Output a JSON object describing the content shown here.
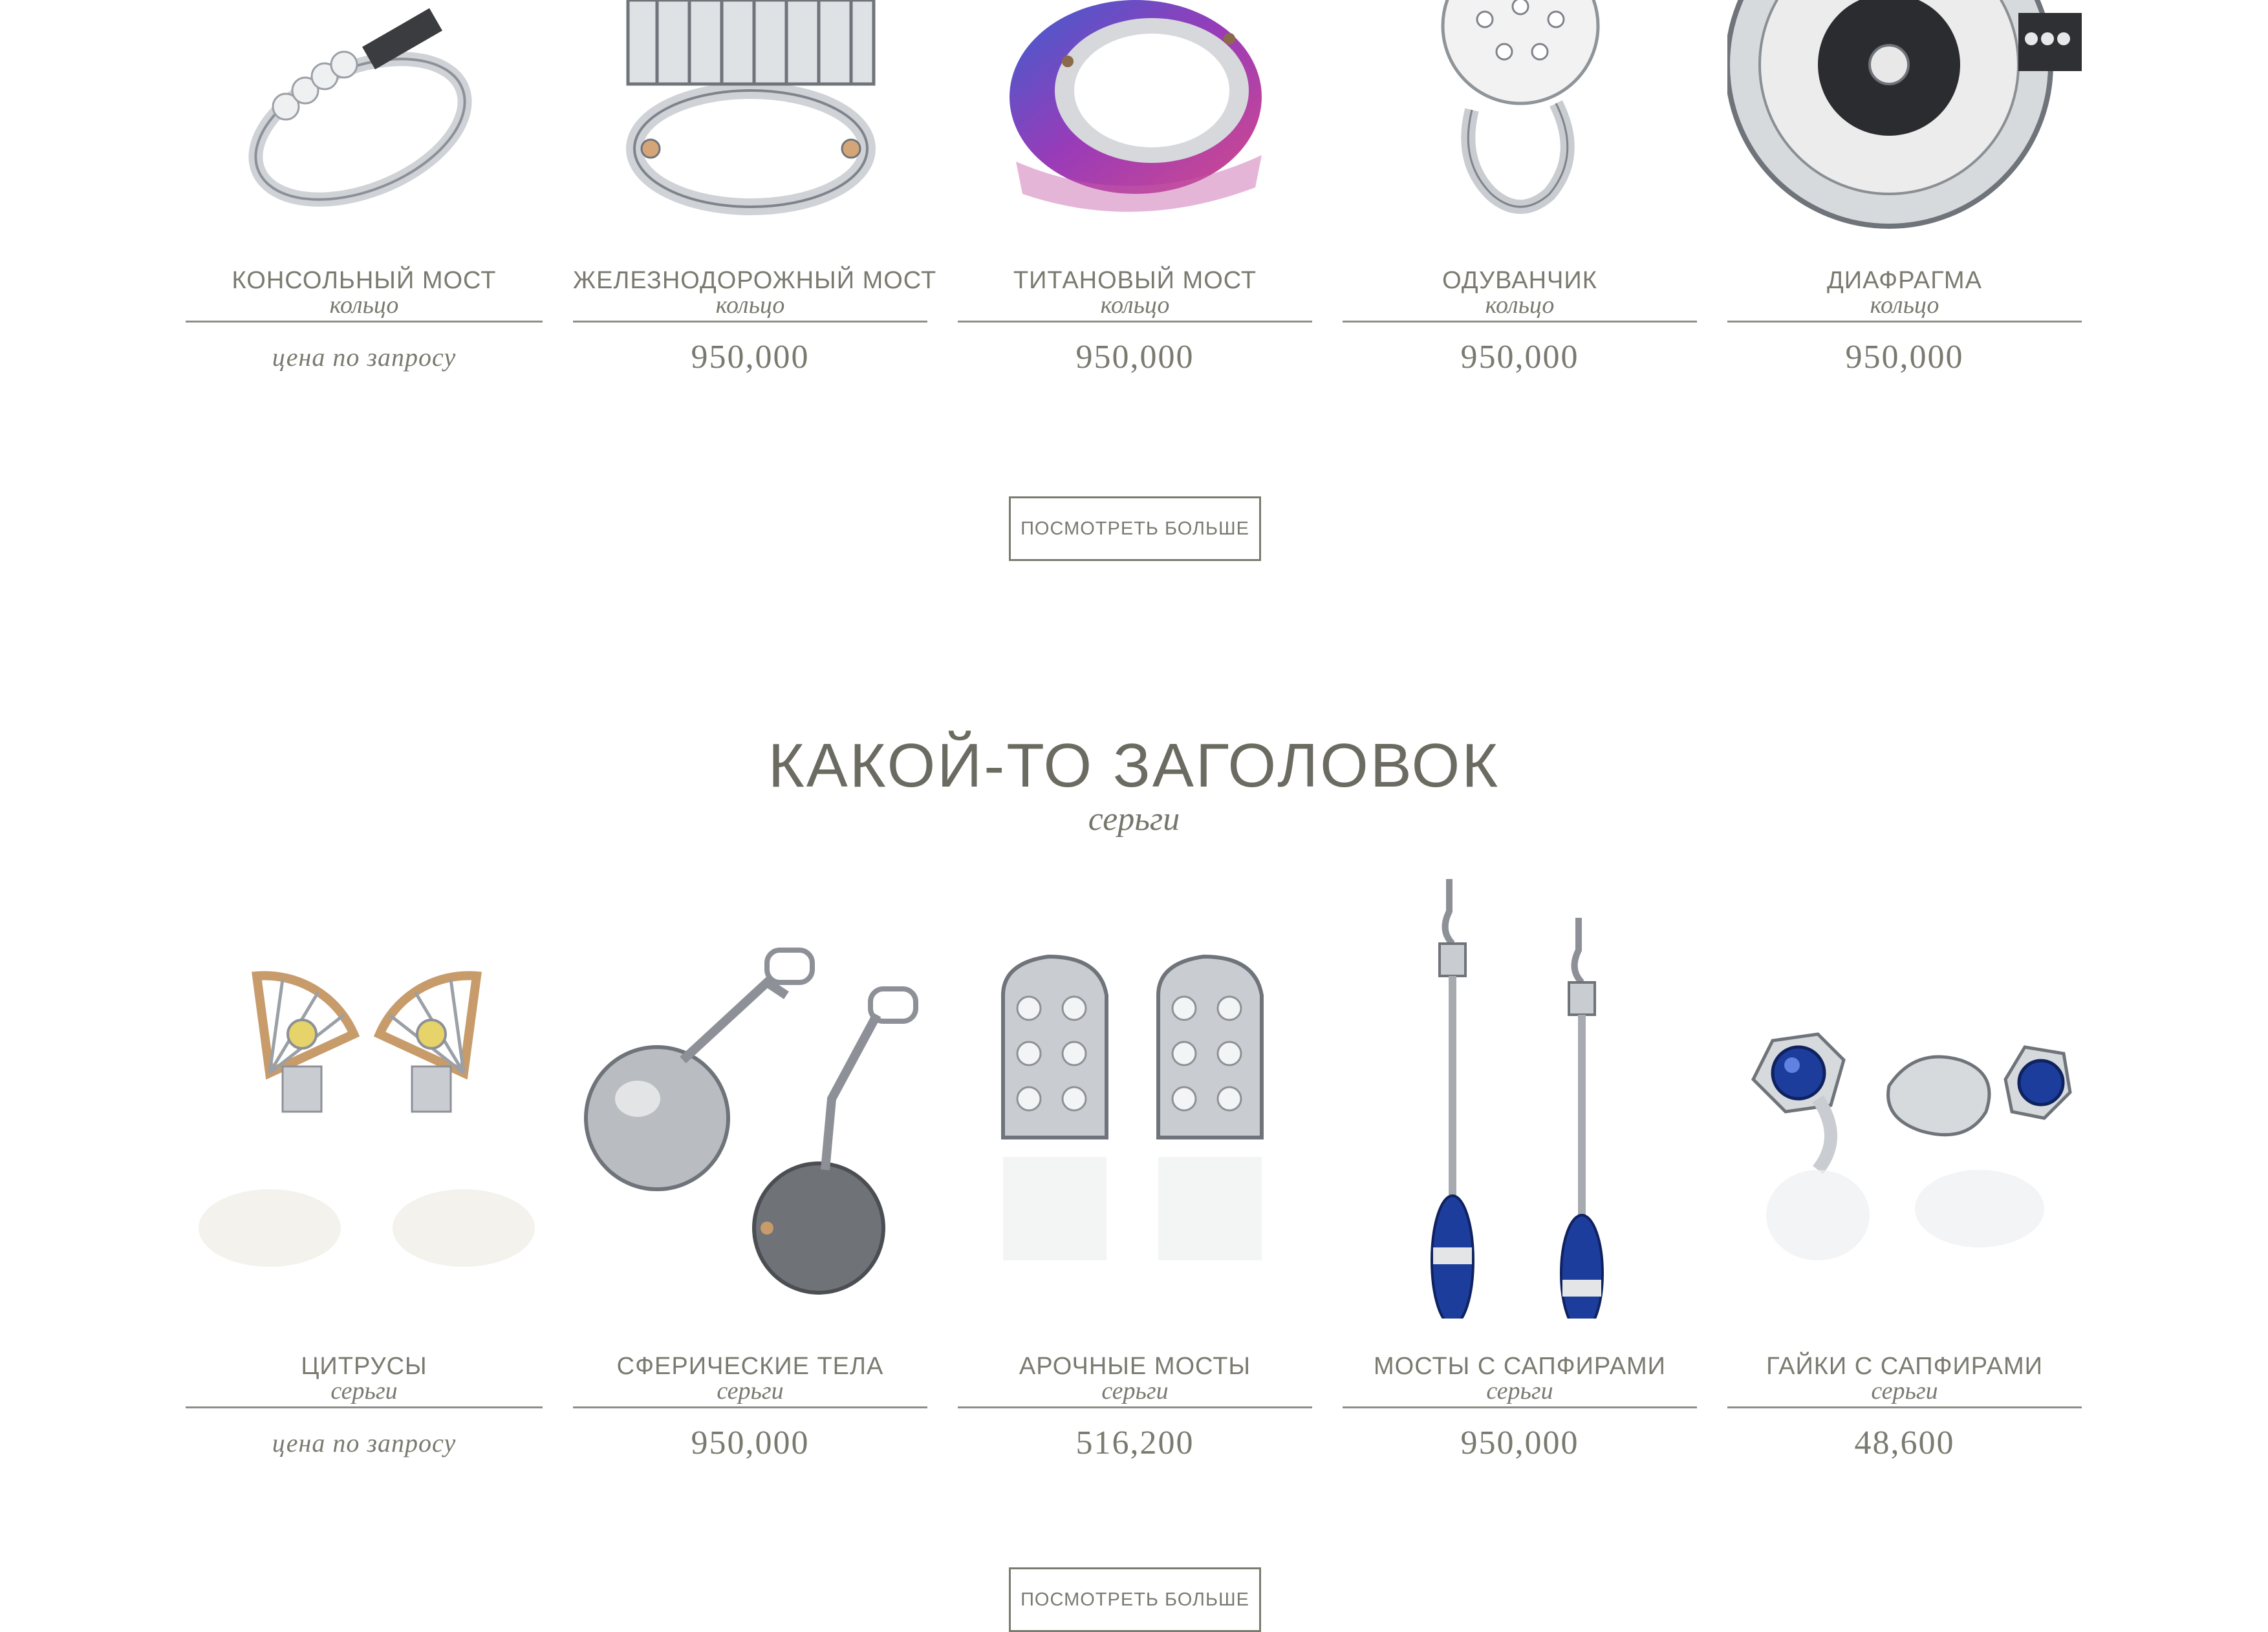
{
  "rings_section": {
    "products": [
      {
        "name": "КОНСОЛЬНЫЙ МОСТ",
        "type": "кольцо",
        "price": "цена по запросу",
        "image": "ring-icon"
      },
      {
        "name": "ЖЕЛЕЗНОДОРОЖНЫЙ МОСТ",
        "type": "кольцо",
        "price": "950,000",
        "image": "ring-icon"
      },
      {
        "name": "ТИТАНОВЫЙ МОСТ",
        "type": "кольцо",
        "price": "950,000",
        "image": "titanium-ring-icon"
      },
      {
        "name": "ОДУВАНЧИК",
        "type": "кольцо",
        "price": "950,000",
        "image": "dandelion-ring-icon"
      },
      {
        "name": "ДИАФРАГМА",
        "type": "кольцо",
        "price": "950,000",
        "image": "diaphragm-ring-icon"
      }
    ],
    "more_button": "ПОСМОТРЕТЬ БОЛЬШЕ"
  },
  "earrings_section": {
    "title": "КАКОЙ-ТО ЗАГОЛОВОК",
    "subtitle": "серьги",
    "products": [
      {
        "name": "ЦИТРУСЫ",
        "type": "серьги",
        "price": "цена по запросу",
        "image": "citrus-earrings-icon"
      },
      {
        "name": "СФЕРИЧЕСКИЕ ТЕЛА",
        "type": "серьги",
        "price": "950,000",
        "image": "sphere-earrings-icon"
      },
      {
        "name": "АРОЧНЫЕ МОСТЫ",
        "type": "серьги",
        "price": "516,200",
        "image": "arch-earrings-icon"
      },
      {
        "name": "МОСТЫ С САПФИРАМИ",
        "type": "серьги",
        "price": "950,000",
        "image": "sapphire-drop-earrings-icon"
      },
      {
        "name": "ГАЙКИ С САПФИРАМИ",
        "type": "серьги",
        "price": "48,600",
        "image": "sapphire-nut-earrings-icon"
      }
    ],
    "more_button": "ПОСМОТРЕТЬ БОЛЬШЕ"
  },
  "colors": {
    "text": "#7a7a70",
    "title": "#6b6b62",
    "metal": "#c9ccd0",
    "gold": "#c89b6a",
    "sapphire": "#1d3d9c",
    "titanium_purple": "#9a3bb8"
  }
}
